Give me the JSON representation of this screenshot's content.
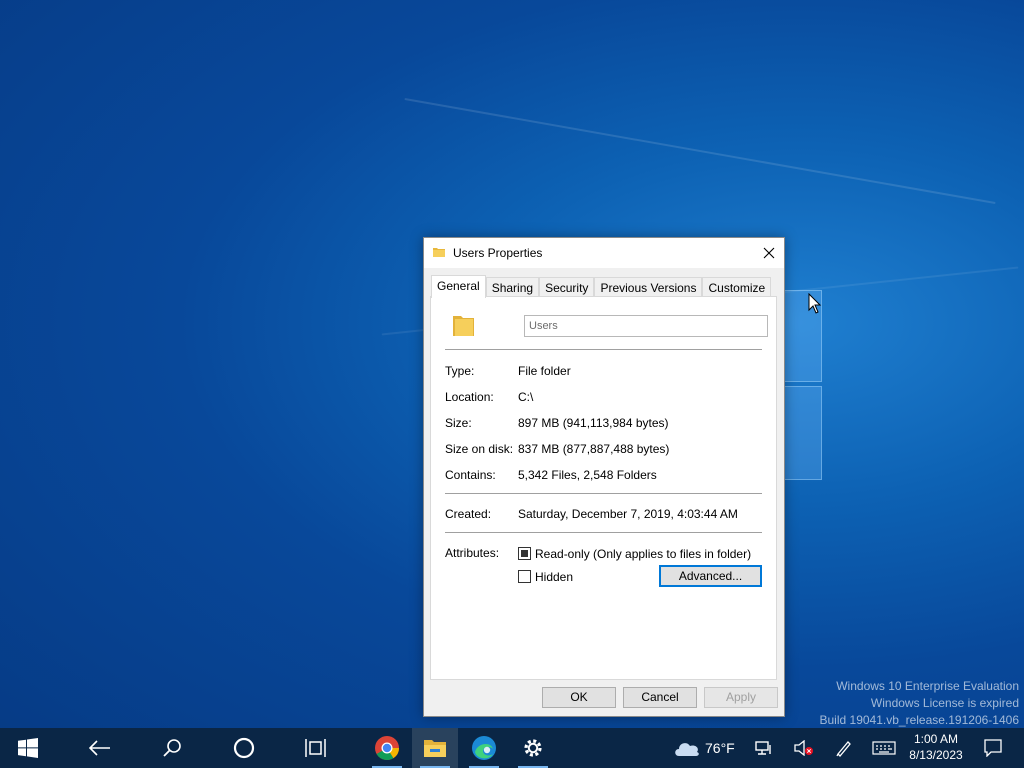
{
  "dialog": {
    "title": "Users Properties",
    "tabs": [
      "General",
      "Sharing",
      "Security",
      "Previous Versions",
      "Customize"
    ],
    "name_value": "Users",
    "fields": {
      "type_label": "Type:",
      "type_value": "File folder",
      "location_label": "Location:",
      "location_value": "C:\\",
      "size_label": "Size:",
      "size_value": "897 MB (941,113,984 bytes)",
      "size_on_disk_label": "Size on disk:",
      "size_on_disk_value": "837 MB (877,887,488 bytes)",
      "contains_label": "Contains:",
      "contains_value": "5,342 Files, 2,548 Folders",
      "created_label": "Created:",
      "created_value": "Saturday, December 7, 2019, 4:03:44 AM",
      "attributes_label": "Attributes:"
    },
    "attributes": {
      "readonly_label": "Read-only (Only applies to files in folder)",
      "readonly_checked": true,
      "hidden_label": "Hidden",
      "hidden_checked": false,
      "advanced_label": "Advanced..."
    },
    "buttons": {
      "ok": "OK",
      "cancel": "Cancel",
      "apply": "Apply"
    }
  },
  "watermark": {
    "line1": "Windows 10 Enterprise Evaluation",
    "line2": "Windows License is expired",
    "line3": "Build 19041.vb_release.191206-1406"
  },
  "taskbar": {
    "icons": [
      "windows-start-icon",
      "back-icon",
      "search-icon",
      "cortana-icon",
      "task-view-icon",
      "chrome-icon",
      "file-explorer-icon",
      "edge-icon",
      "settings-icon"
    ],
    "weather_temp": "76°F",
    "clock_time": "1:00 AM",
    "clock_date": "8/13/2023"
  },
  "colors": {
    "accent": "#0078d7",
    "taskbar": "#0a2646",
    "folder": "#f6cf5b"
  }
}
